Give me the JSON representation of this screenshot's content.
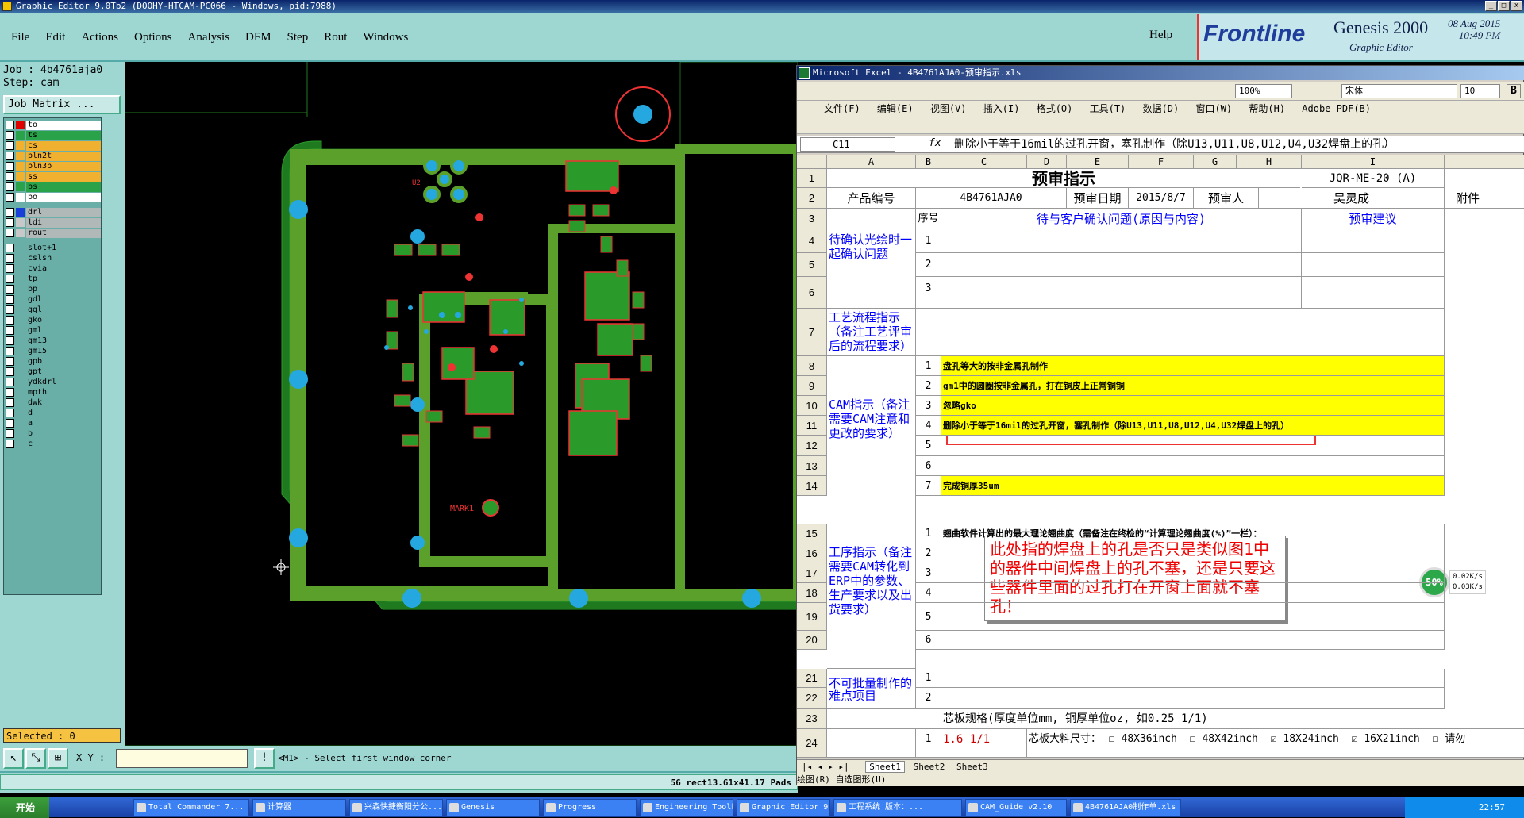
{
  "window": {
    "title": "Graphic Editor 9.0Tb2 (DOOHY-HTCAM-PC066 - Windows, pid:7988)"
  },
  "menu": [
    "File",
    "Edit",
    "Actions",
    "Options",
    "Analysis",
    "DFM",
    "Step",
    "Rout",
    "Windows"
  ],
  "help": "Help",
  "brand": {
    "logo": "Frontline",
    "product": "Genesis 2000",
    "sub": "Graphic Editor",
    "date": "08 Aug 2015",
    "time": "10:49 PM"
  },
  "job": {
    "job_label": "Job : 4b4761aja0",
    "step_label": "Step: cam",
    "matrix": "Job Matrix ..."
  },
  "layers": [
    {
      "name": "to",
      "color": "#e00000",
      "bg": "#ffffff"
    },
    {
      "name": "ts",
      "color": "#2aa24a",
      "bg": "#2aa24a"
    },
    {
      "name": "cs",
      "color": "#f0b030",
      "bg": "#f0b030"
    },
    {
      "name": "pln2t",
      "color": "#f0b030",
      "bg": "#f0b030"
    },
    {
      "name": "pln3b",
      "color": "#f0b030",
      "bg": "#f0b030"
    },
    {
      "name": "ss",
      "color": "#f0b030",
      "bg": "#f0b030"
    },
    {
      "name": "bs",
      "color": "#2aa24a",
      "bg": "#2aa24a"
    },
    {
      "name": "bo",
      "color": "#ffffff",
      "bg": "#ffffff"
    },
    {
      "name": "drl",
      "color": "#1a3fd8",
      "bg": "#b0b8b8"
    },
    {
      "name": "ldi",
      "color": "#c8c8c8",
      "bg": "#b0b8b8"
    },
    {
      "name": "rout",
      "color": "#c8c8c8",
      "bg": "#b0b8b8"
    },
    {
      "name": "slot+1",
      "color": "#6aaea8",
      "bg": "#6aaea8"
    },
    {
      "name": "cslsh",
      "color": "#6aaea8",
      "bg": "#6aaea8"
    },
    {
      "name": "cvia",
      "color": "#6aaea8",
      "bg": "#6aaea8"
    },
    {
      "name": "tp",
      "color": "#6aaea8",
      "bg": "#6aaea8"
    },
    {
      "name": "bp",
      "color": "#6aaea8",
      "bg": "#6aaea8"
    },
    {
      "name": "gdl",
      "color": "#6aaea8",
      "bg": "#6aaea8"
    },
    {
      "name": "ggl",
      "color": "#6aaea8",
      "bg": "#6aaea8"
    },
    {
      "name": "gko",
      "color": "#6aaea8",
      "bg": "#6aaea8"
    },
    {
      "name": "gml",
      "color": "#6aaea8",
      "bg": "#6aaea8"
    },
    {
      "name": "gm13",
      "color": "#6aaea8",
      "bg": "#6aaea8"
    },
    {
      "name": "gm15",
      "color": "#6aaea8",
      "bg": "#6aaea8"
    },
    {
      "name": "gpb",
      "color": "#6aaea8",
      "bg": "#6aaea8"
    },
    {
      "name": "gpt",
      "color": "#6aaea8",
      "bg": "#6aaea8"
    },
    {
      "name": "ydkdrl",
      "color": "#6aaea8",
      "bg": "#6aaea8"
    },
    {
      "name": "mpth",
      "color": "#6aaea8",
      "bg": "#6aaea8"
    },
    {
      "name": "dwk",
      "color": "#6aaea8",
      "bg": "#6aaea8"
    },
    {
      "name": "d",
      "color": "#6aaea8",
      "bg": "#6aaea8"
    },
    {
      "name": "a",
      "color": "#6aaea8",
      "bg": "#6aaea8"
    },
    {
      "name": "b",
      "color": "#6aaea8",
      "bg": "#6aaea8"
    },
    {
      "name": "c",
      "color": "#6aaea8",
      "bg": "#6aaea8"
    }
  ],
  "selected": "Selected : 0",
  "canvas_labels": {
    "mark": "MARK1",
    "u2": "U2"
  },
  "xy_label": "X Y :",
  "prompt_text": "<M1> - Select first window corner",
  "status_text": "56 rect13.61x41.17 Pads",
  "excel": {
    "title": "Microsoft Excel - 4B4761AJA0-预审指示.xls",
    "menu": [
      "文件(F)",
      "编辑(E)",
      "视图(V)",
      "插入(I)",
      "格式(O)",
      "工具(T)",
      "数据(D)",
      "窗口(W)",
      "帮助(H)",
      "Adobe PDF(B)"
    ],
    "zoom": "100%",
    "font": "宋体",
    "size": "10",
    "namebox": "C11",
    "formula": "删除小于等于16mil的过孔开窗，塞孔制作（除U13,U11,U8,U12,U4,U32焊盘上的孔）",
    "cols": [
      "A",
      "B",
      "C",
      "D",
      "E",
      "F",
      "G",
      "H",
      "I"
    ],
    "title_cell": "预审指示",
    "code": "JQR-ME-20  (A)",
    "product_label": "产品编号",
    "product": "4B4761AJA0",
    "date_label": "预审日期",
    "date": "2015/8/7",
    "reviewer_label": "预审人",
    "reviewer": "吴灵成",
    "attach": "附件",
    "seq": "序号",
    "confirm_hdr": "待与客户确认问题(原因与内容)",
    "suggest_hdr": "预审建议",
    "sec1": "待确认光绘时一起确认问题",
    "sec2": "工艺流程指示（备注工艺评审后的流程要求）",
    "sec3": "CAM指示（备注需要CAM注意和更改的要求）",
    "sec4": "工序指示（备注需要CAM转化到ERP中的参数、生产要求以及出货要求）",
    "sec5": "不可批量制作的难点项目",
    "cam": [
      "盘孔等大的按非金属孔制作",
      "gm1中的圆圈按非金属孔，打在铜皮上正常铜铜",
      "忽略gko",
      "删除小于等于16mil的过孔开窗，塞孔制作（除U13,U11,U8,U12,U4,U32焊盘上的孔）",
      "",
      "",
      "完成铜厚35um"
    ],
    "proc1": "翘曲软件计算出的最大理论翘曲度（需备注在终检的“计算理论翘曲度(%)”一栏）：",
    "core_label": "芯板规格(厚度单位mm, 铜厚单位oz, 如0.25 1/1)",
    "core_val": "1.6 1/1",
    "core_size": "芯板大料尺寸：",
    "opts": [
      "48X36inch",
      "48X42inch",
      "18X24inch",
      "16X21inch",
      "请勿"
    ],
    "note": "此处指的焊盘上的孔是否只是类似图1中的器件中间焊盘上的孔不塞，还是只要这些器件里面的过孔打在开窗上面就不塞孔！",
    "tabs": [
      "Sheet1",
      "Sheet2",
      "Sheet3"
    ],
    "draw": "绘图(R)  自选图形(U)",
    "net_pct": "50%",
    "net_up": "0.02K/s",
    "net_down": "0.03K/s"
  },
  "taskbar": {
    "start": "开始",
    "tasks": [
      "Total Commander 7...",
      "计算器",
      "兴森快捷衡阳分公...",
      "Genesis",
      "Progress",
      "Engineering Toolk...",
      "Graphic Editor 9...",
      "工程系统  版本：...",
      "CAM_Guide v2.10",
      "4B4761AJA0制作单.xls"
    ],
    "time": "22:57"
  }
}
